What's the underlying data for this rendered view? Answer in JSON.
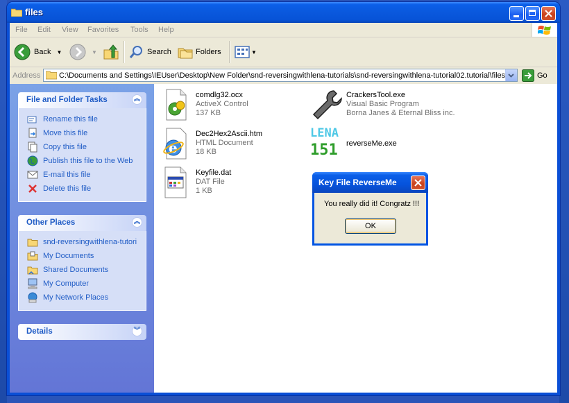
{
  "window": {
    "title": "files"
  },
  "menu": [
    "File",
    "Edit",
    "View",
    "Favorites",
    "Tools",
    "Help"
  ],
  "toolbar": {
    "back": "Back",
    "search": "Search",
    "folders": "Folders"
  },
  "address": {
    "label": "Address",
    "path": "C:\\Documents and Settings\\IEUser\\Desktop\\New Folder\\snd-reversingwithlena-tutorials\\snd-reversingwithlena-tutorial02.tutorial\\files",
    "go": "Go"
  },
  "tasks": {
    "title": "File and Folder Tasks",
    "items": [
      "Rename this file",
      "Move this file",
      "Copy this file",
      "Publish this file to the Web",
      "E-mail this file",
      "Delete this file"
    ]
  },
  "other_places": {
    "title": "Other Places",
    "items": [
      "snd-reversingwithlena-tutori",
      "My Documents",
      "Shared Documents",
      "My Computer",
      "My Network Places"
    ]
  },
  "details": {
    "title": "Details"
  },
  "files": [
    {
      "name": "comdlg32.ocx",
      "type": "ActiveX Control",
      "size": "137 KB"
    },
    {
      "name": "CrackersTool.exe",
      "type": "Visual Basic Program",
      "size": "Borna Janes & Eternal Bliss inc."
    },
    {
      "name": "Dec2Hex2Ascii.htm",
      "type": "HTML Document",
      "size": "18 KB"
    },
    {
      "name": "reverseMe.exe",
      "type": "",
      "size": ""
    },
    {
      "name": "Keyfile.dat",
      "type": "DAT File",
      "size": "1 KB"
    }
  ],
  "lena_icon": {
    "line1": "LENA",
    "line2": "151"
  },
  "dialog": {
    "title": "Key File ReverseMe",
    "message": "You really did it! Congratz !!!",
    "ok": "OK"
  },
  "colors": {
    "title_bar": "#0a58dd",
    "task_link": "#215dc6",
    "left_pane": "#7ba2e7",
    "close": "#c8401a"
  }
}
